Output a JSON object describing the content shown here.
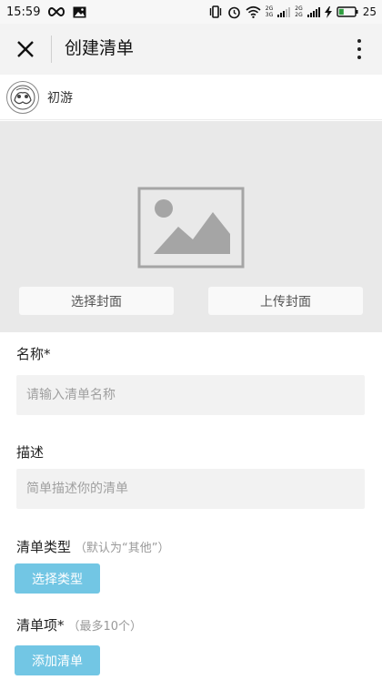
{
  "status_bar": {
    "time": "15:59",
    "net_2g_top": "2G",
    "net_3g_bottom": "3G",
    "net_2g_b": "2G",
    "net_2g_b2": "2G",
    "battery_level": "25"
  },
  "header": {
    "title": "创建清单"
  },
  "user": {
    "name": "初游"
  },
  "cover": {
    "select_label": "选择封面",
    "upload_label": "上传封面"
  },
  "form": {
    "name_label": "名称*",
    "name_placeholder": "请输入清单名称",
    "desc_label": "描述",
    "desc_placeholder": "简单描述你的清单",
    "type_label": "清单类型",
    "type_hint": "（默认为“其他”）",
    "type_button": "选择类型",
    "items_label": "清单项*",
    "items_hint": "（最多10个）",
    "items_button": "添加清单"
  },
  "colors": {
    "accent_button": "#72c6e4",
    "battery_green": "#2e9e3f"
  }
}
